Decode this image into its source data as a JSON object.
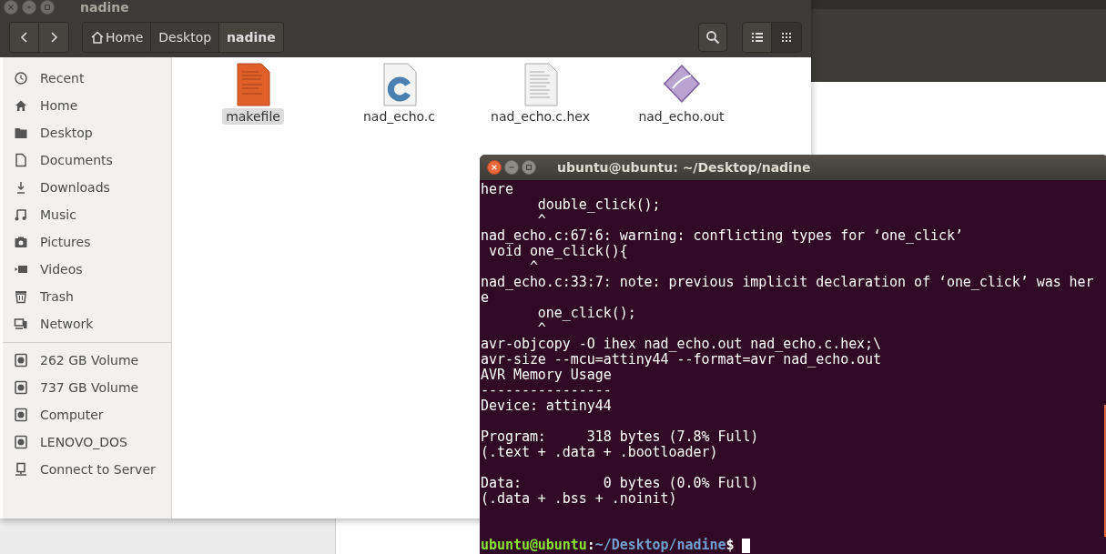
{
  "file_manager": {
    "title": "nadine",
    "breadcrumbs": [
      {
        "label": "Home",
        "kind": "home",
        "selected": false
      },
      {
        "label": "Desktop",
        "kind": "folder",
        "selected": false
      },
      {
        "label": "nadine",
        "kind": "folder",
        "selected": true
      }
    ],
    "views": [
      {
        "kind": "list",
        "selected": false
      },
      {
        "kind": "grid",
        "selected": true
      }
    ],
    "sidebar": [
      [
        {
          "label": "Recent",
          "kind": "clock"
        },
        {
          "label": "Home",
          "kind": "home"
        },
        {
          "label": "Desktop",
          "kind": "folder"
        },
        {
          "label": "Documents",
          "kind": "document"
        },
        {
          "label": "Downloads",
          "kind": "download"
        },
        {
          "label": "Music",
          "kind": "music"
        },
        {
          "label": "Pictures",
          "kind": "camera"
        },
        {
          "label": "Videos",
          "kind": "video"
        },
        {
          "label": "Trash",
          "kind": "trash"
        },
        {
          "label": "Network",
          "kind": "network"
        }
      ],
      [
        {
          "label": "262 GB Volume",
          "kind": "drive"
        },
        {
          "label": "737 GB Volume",
          "kind": "drive"
        },
        {
          "label": "Computer",
          "kind": "drive"
        },
        {
          "label": "LENOVO_DOS",
          "kind": "drive"
        },
        {
          "label": "Connect to Server",
          "kind": "server"
        }
      ]
    ],
    "files": [
      {
        "name": "makefile",
        "kind": "makefile",
        "selected": true
      },
      {
        "name": "nad_echo.c",
        "kind": "c-source",
        "selected": false
      },
      {
        "name": "nad_echo.c.hex",
        "kind": "text",
        "selected": false
      },
      {
        "name": "nad_echo.out",
        "kind": "binary",
        "selected": false
      }
    ]
  },
  "terminal": {
    "title": "ubuntu@ubuntu: ~/Desktop/nadine",
    "blocks": [
      [
        "here",
        "       double_click();",
        "       ^",
        "nad_echo.c:67:6: warning: conflicting types for ‘one_click’",
        " void one_click(){",
        "      ^",
        "nad_echo.c:33:7: note: previous implicit declaration of ‘one_click’ was her",
        "e",
        "       one_click();",
        "       ^",
        "avr-objcopy -O ihex nad_echo.out nad_echo.c.hex;\\",
        "avr-size --mcu=attiny44 --format=avr nad_echo.out",
        "AVR Memory Usage",
        "----------------",
        "Device: attiny44"
      ],
      [
        "Program:     318 bytes (7.8% Full)",
        "(.text + .data + .bootloader)"
      ],
      [
        "Data:          0 bytes (0.0% Full)",
        "(.data + .bss + .noinit)"
      ]
    ],
    "prompt": {
      "user_host": "ubuntu@ubuntu",
      "separator": ":",
      "path": "~/Desktop/nadine",
      "symbol": "$"
    }
  }
}
